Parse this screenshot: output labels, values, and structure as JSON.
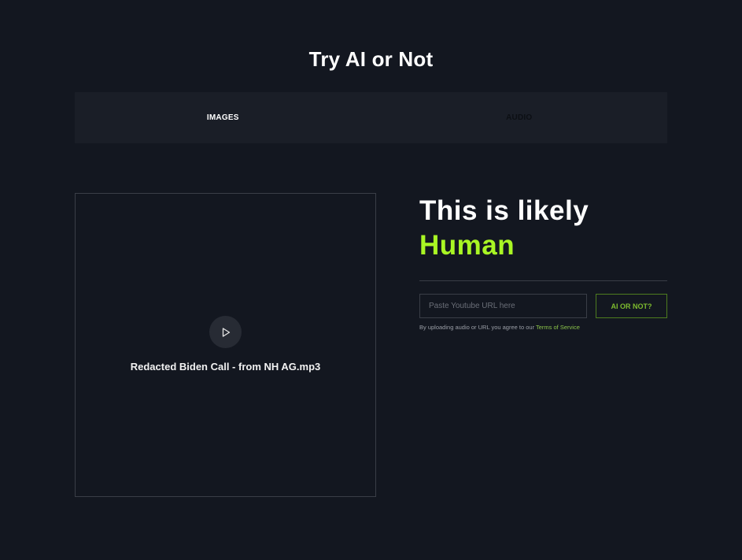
{
  "header": {
    "title": "Try AI or Not"
  },
  "tabs": [
    {
      "label": "IMAGES",
      "active": true
    },
    {
      "label": "AUDIO",
      "active": false
    }
  ],
  "upload": {
    "file_name": "Redacted Biden Call - from NH AG.mp3",
    "play_icon": "play-icon"
  },
  "result": {
    "line1": "This is likely",
    "verdict": "Human"
  },
  "form": {
    "url_placeholder": "Paste Youtube URL here",
    "url_value": "",
    "submit_label": "AI OR NOT?",
    "tos_text": "By uploading audio or URL you agree to our ",
    "tos_link": "Terms of Service"
  },
  "colors": {
    "background": "#131720",
    "accent": "#a9f624",
    "button_border": "#4d7c1f"
  }
}
